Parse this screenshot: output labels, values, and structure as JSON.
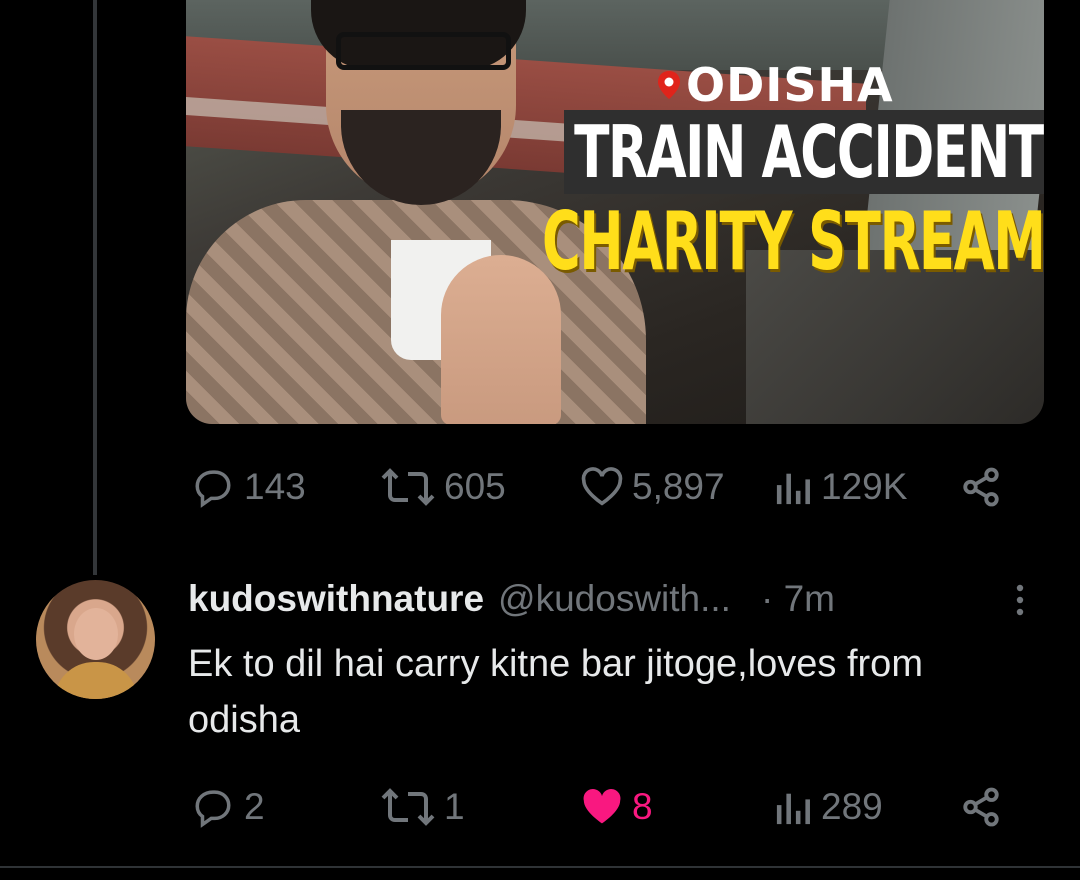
{
  "media": {
    "location": "ODISHA",
    "headline_line1": "TRAIN ACCIDENT",
    "headline_line2": "CHARITY STREAM"
  },
  "tweet_actions": {
    "replies": "143",
    "retweets": "605",
    "likes": "5,897",
    "views": "129K"
  },
  "reply": {
    "username": "kudoswithnature",
    "handle": "@kudoswith...",
    "time": "· 7m",
    "text": "Ek to dil hai carry kitne bar jitoge,loves from odisha",
    "actions": {
      "replies": "2",
      "retweets": "1",
      "likes": "8",
      "views": "289"
    }
  },
  "colors": {
    "background": "#000000",
    "muted": "#71767b",
    "text": "#e7e9ea",
    "like_active": "#f91880",
    "headline_yellow": "#ffde1a"
  },
  "icons": [
    "reply-icon",
    "retweet-icon",
    "like-icon",
    "views-icon",
    "share-icon",
    "more-icon",
    "location-pin-icon"
  ]
}
